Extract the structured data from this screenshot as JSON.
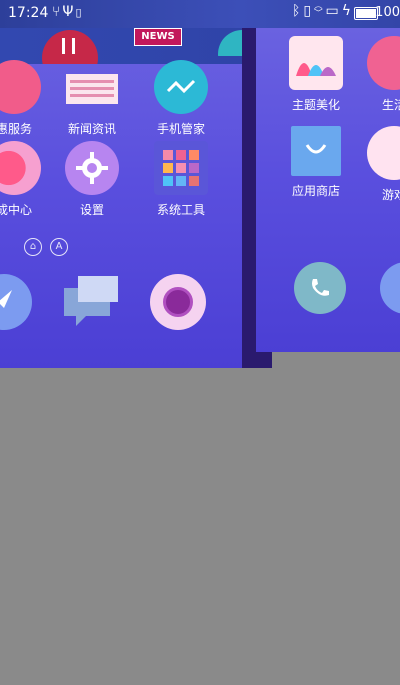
{
  "status_bar": {
    "time": "17:24",
    "left_icons": [
      "usb-icon",
      "download-icon",
      "bug-icon"
    ],
    "right_icons": [
      "bluetooth-icon",
      "vibrate-icon",
      "wifi-icon",
      "sim-icon",
      "charging-icon"
    ],
    "battery": "100"
  },
  "left_screen": {
    "news_badge": "NEWS",
    "apps": [
      {
        "label": "惠服务"
      },
      {
        "label": "新闻资讯"
      },
      {
        "label": "手机管家"
      },
      {
        "label": "成中心"
      },
      {
        "label": "设置"
      },
      {
        "label": "系统工具"
      }
    ],
    "page_indicators": [
      "home-indicator",
      "A"
    ],
    "dock": [
      {
        "name": "browser"
      },
      {
        "name": "messages"
      },
      {
        "name": "camera"
      }
    ]
  },
  "right_screen": {
    "apps": [
      {
        "label": "主题美化"
      },
      {
        "label": "生活"
      },
      {
        "label": "应用商店"
      },
      {
        "label": "游戏"
      }
    ],
    "dock": [
      {
        "name": "phone"
      },
      {
        "name": "browser"
      }
    ]
  },
  "colors": {
    "wallpaper_top": "#6a62e0",
    "wallpaper_bottom": "#4b3fd4",
    "background": "#8a8a8a",
    "news_badge": "#c2185b"
  }
}
